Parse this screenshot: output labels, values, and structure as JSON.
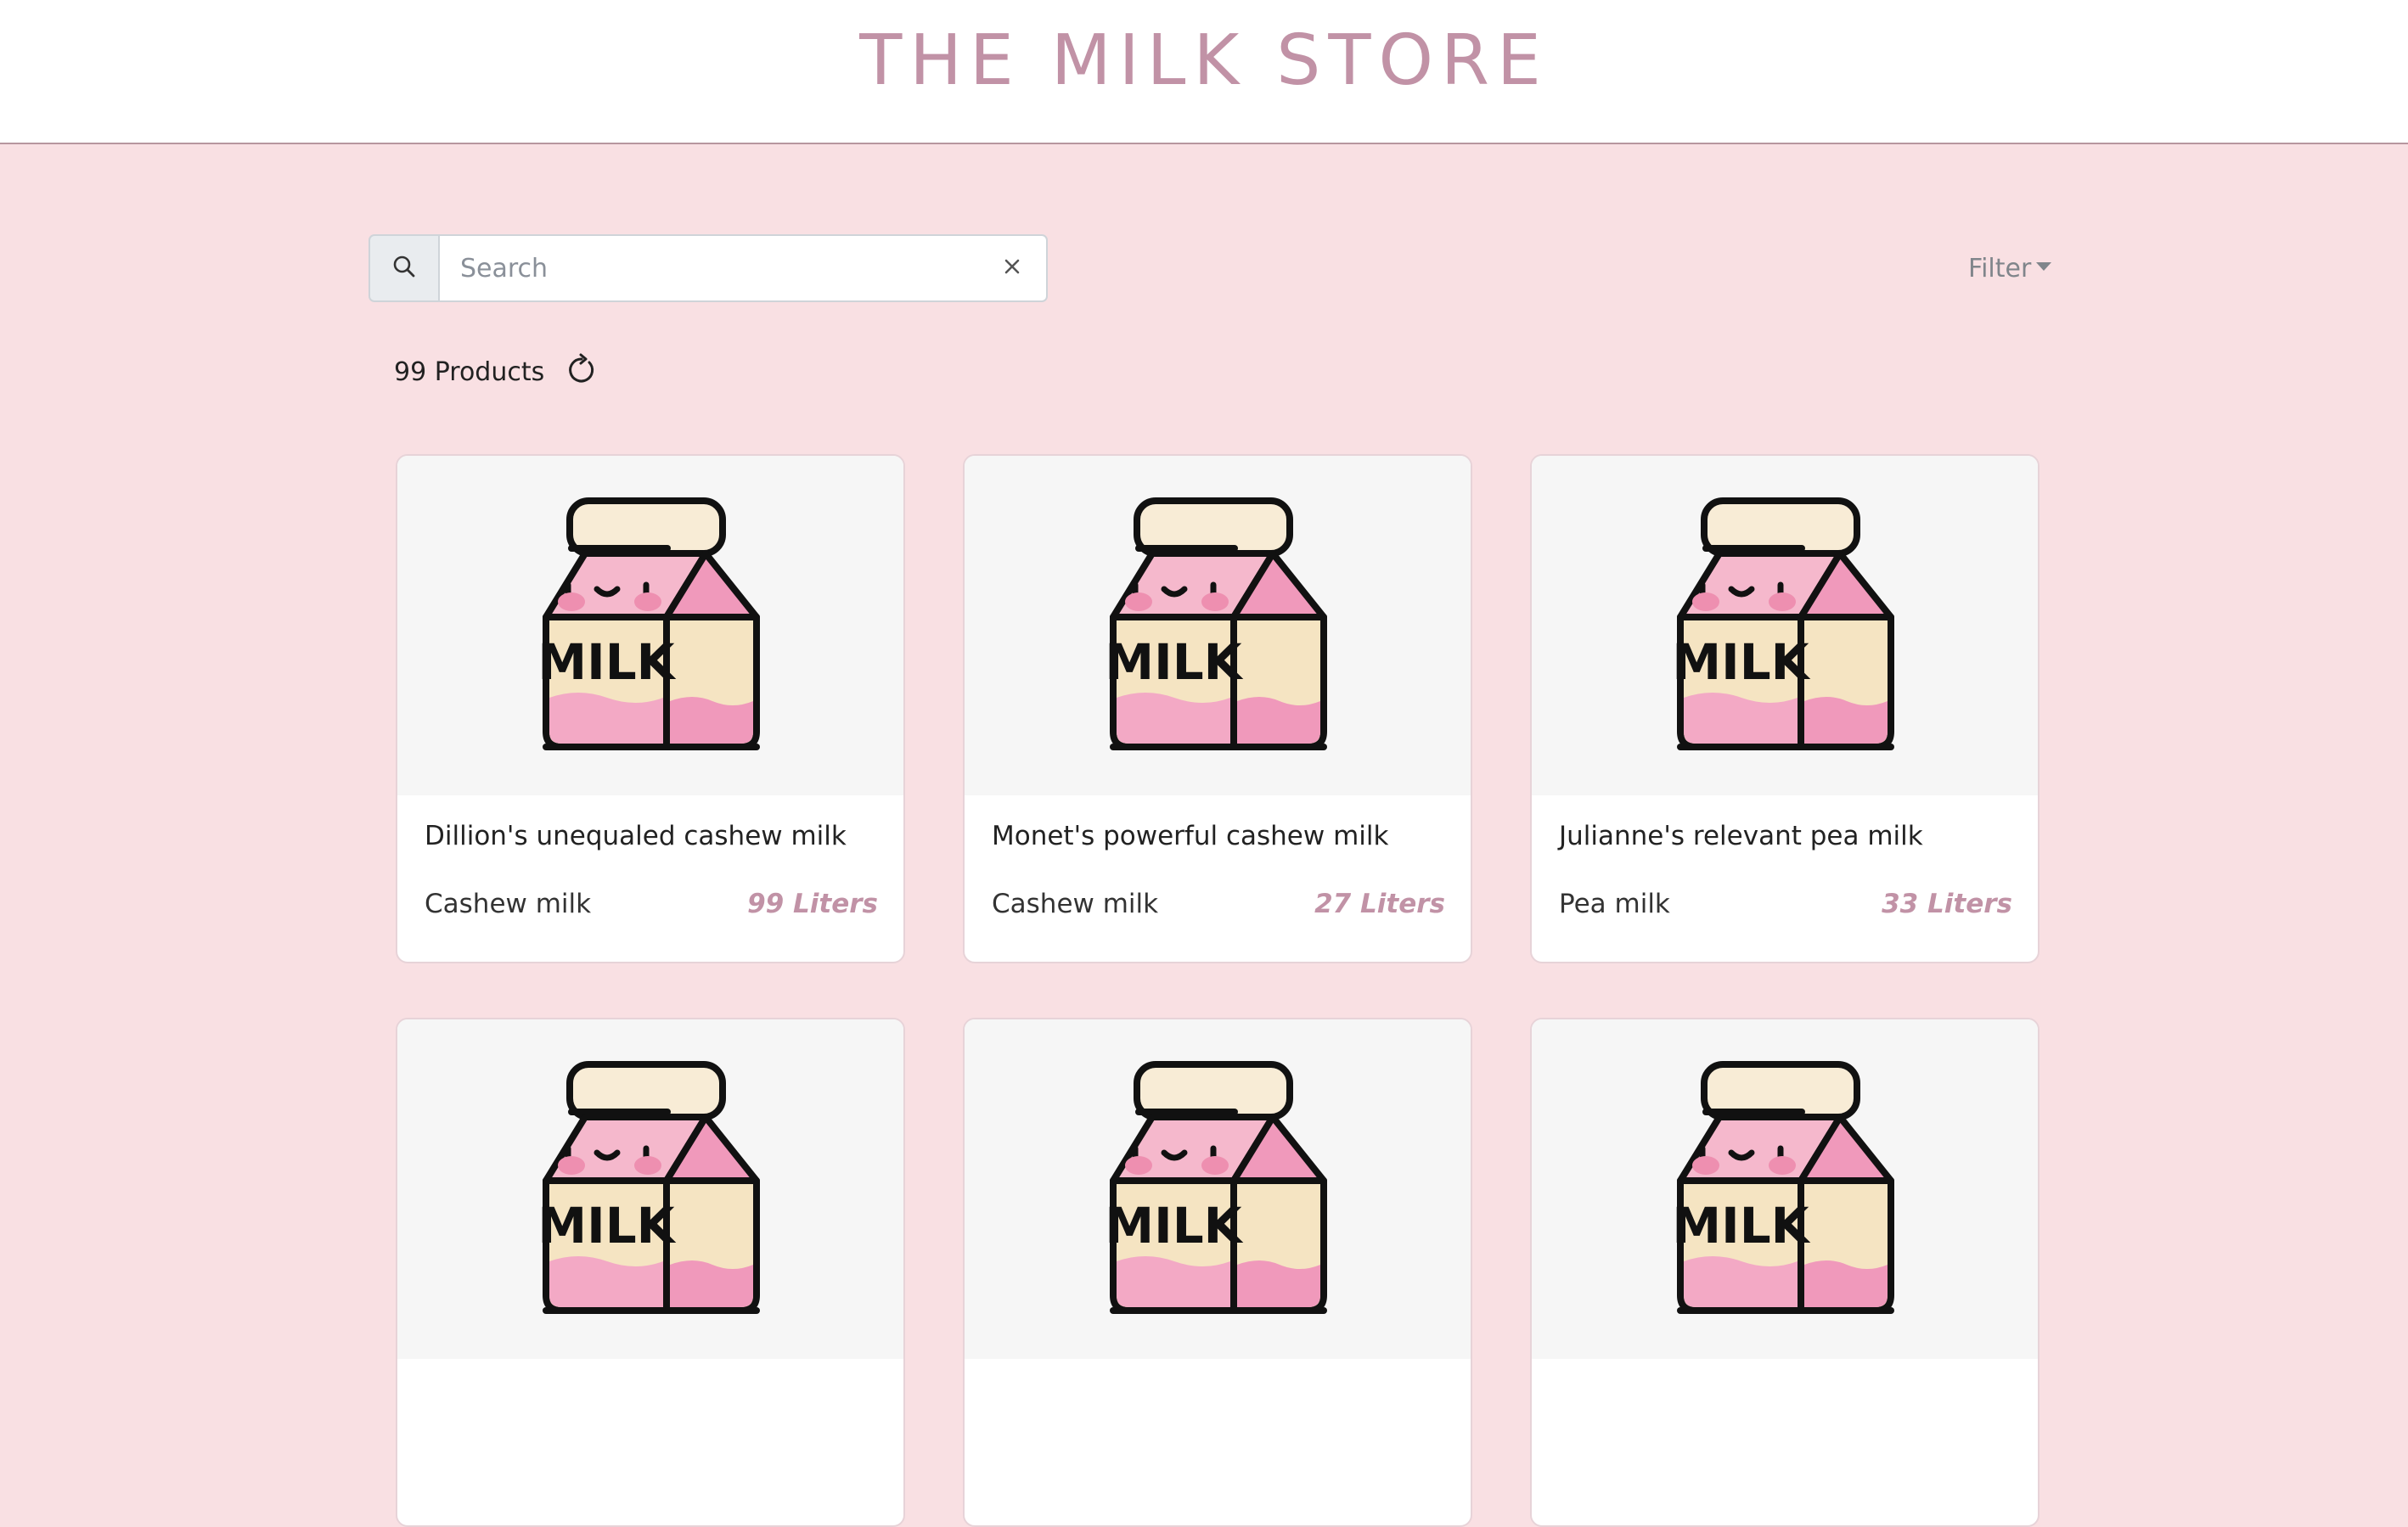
{
  "header": {
    "title": "THE MILK STORE"
  },
  "search": {
    "placeholder": "Search",
    "value": "",
    "icon": "search-icon",
    "clear_icon": "close-icon"
  },
  "filter": {
    "label": "Filter",
    "icon": "caret-down-icon"
  },
  "products_summary": {
    "count_label": "99 Products",
    "refresh_icon": "refresh-icon"
  },
  "products": [
    {
      "name": "Dillion's unequaled cashew milk",
      "type": "Cashew milk",
      "volume": "99 Liters"
    },
    {
      "name": "Monet's powerful cashew milk",
      "type": "Cashew milk",
      "volume": "27 Liters"
    },
    {
      "name": "Julianne's relevant pea milk",
      "type": "Pea milk",
      "volume": "33 Liters"
    },
    {
      "name": "",
      "type": "",
      "volume": ""
    },
    {
      "name": "",
      "type": "",
      "volume": ""
    },
    {
      "name": "",
      "type": "",
      "volume": ""
    }
  ],
  "image_label": "MILK",
  "colors": {
    "page_background": "#f9e0e3",
    "accent": "#c192a6",
    "carton_pink": "#f5c1d5",
    "carton_cream": "#f5e6c8"
  }
}
